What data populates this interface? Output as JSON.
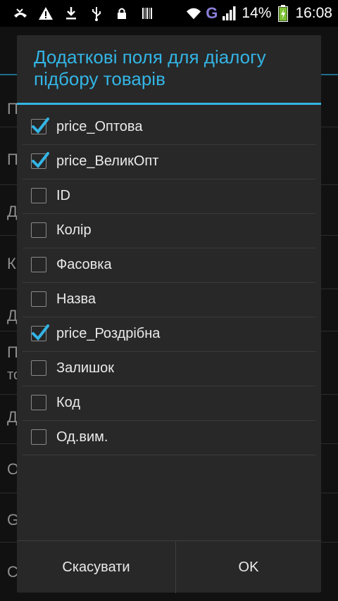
{
  "status_bar": {
    "battery": "14%",
    "time": "16:08",
    "network": "G",
    "icons": [
      "missed-call-icon",
      "warning-icon",
      "download-icon",
      "usb-icon",
      "lock-icon",
      "barcode-icon",
      "wifi-icon",
      "signal-icon",
      "battery-charging-icon"
    ]
  },
  "background": {
    "items": [
      "П",
      "П",
      "Д",
      "К",
      "Д",
      "П",
      "Д",
      "О",
      "G",
      "С"
    ],
    "item2_line2": "то"
  },
  "dialog": {
    "title_line1": "Додаткові поля для діалогу",
    "title_line2": "підбору товарів",
    "options": [
      {
        "label": "price_Оптова",
        "checked": true
      },
      {
        "label": "price_ВеликОпт",
        "checked": true
      },
      {
        "label": "ID",
        "checked": false
      },
      {
        "label": "Колір",
        "checked": false
      },
      {
        "label": "Фасовка",
        "checked": false
      },
      {
        "label": "Назва",
        "checked": false
      },
      {
        "label": "price_Роздрібна",
        "checked": true
      },
      {
        "label": "Залишок",
        "checked": false
      },
      {
        "label": "Код",
        "checked": false
      },
      {
        "label": "Од.вим.",
        "checked": false
      }
    ],
    "cancel_label": "Скасувати",
    "ok_label": "OK"
  },
  "colors": {
    "accent": "#33b5e5",
    "dialog_bg": "#282828",
    "status_bar_bg": "#000000"
  }
}
